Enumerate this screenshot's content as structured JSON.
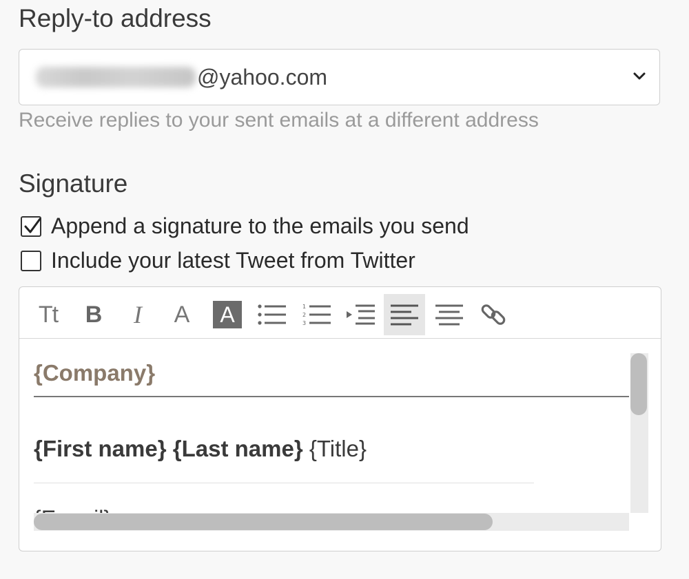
{
  "reply_to": {
    "title": "Reply-to address",
    "selected_email_domain": "@yahoo.com",
    "helper_text": "Receive replies to your sent emails at a different address"
  },
  "signature": {
    "title": "Signature",
    "append_option": {
      "label": "Append a signature to the emails you send",
      "checked": true
    },
    "tweet_option": {
      "label": "Include your latest Tweet from Twitter",
      "checked": false
    },
    "toolbar": [
      {
        "name": "text-size",
        "icon": "text-size-icon",
        "glyph": "Tt"
      },
      {
        "name": "bold",
        "icon": "bold-icon",
        "glyph": "B"
      },
      {
        "name": "italic",
        "icon": "italic-icon",
        "glyph": "I"
      },
      {
        "name": "font-color",
        "icon": "font-color-icon",
        "glyph": "A"
      },
      {
        "name": "highlight",
        "icon": "highlight-icon",
        "glyph": "A"
      },
      {
        "name": "bullet-list",
        "icon": "bullet-list-icon"
      },
      {
        "name": "numbered-list",
        "icon": "numbered-list-icon"
      },
      {
        "name": "indent",
        "icon": "indent-icon"
      },
      {
        "name": "align-left",
        "icon": "align-left-icon",
        "active": true
      },
      {
        "name": "align-center",
        "icon": "align-center-icon"
      },
      {
        "name": "link",
        "icon": "link-icon"
      }
    ],
    "content": {
      "company": "{Company}",
      "first_name": "{First name}",
      "last_name": "{Last name}",
      "title": "{Title}",
      "email": "{E-mail}"
    }
  },
  "colors": {
    "background": "#f8f8f8",
    "company_text": "#8a7a6a",
    "toolbar_active": "#e6e6e6",
    "helper_text": "#9a9a9a"
  }
}
